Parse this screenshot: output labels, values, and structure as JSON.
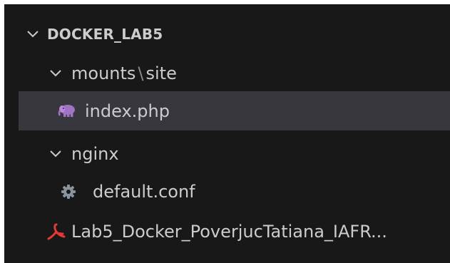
{
  "explorer": {
    "root": {
      "label": "DOCKER_LAB5",
      "expanded": true,
      "icon": "chevron-down-icon"
    },
    "folder_mounts": {
      "segments": [
        "mounts",
        "site"
      ],
      "separator": "\\",
      "expanded": true,
      "icon": "chevron-down-icon"
    },
    "file_index": {
      "label": "index.php",
      "icon": "php-elephant-icon",
      "selected": true
    },
    "folder_nginx": {
      "label": "nginx",
      "expanded": true,
      "icon": "chevron-down-icon"
    },
    "file_default_conf": {
      "label": "default.conf",
      "icon": "gear-icon"
    },
    "file_pdf": {
      "label": "Lab5_Docker_PoverjucTatiana_IAFR",
      "ellipsis": "...",
      "icon": "pdf-icon"
    }
  },
  "colors": {
    "background": "#181818",
    "selected_row": "#37373d",
    "text": "#cccccc",
    "php_icon": "#a074c4",
    "gear_icon": "#8b949e",
    "pdf_icon": "#e53935"
  }
}
